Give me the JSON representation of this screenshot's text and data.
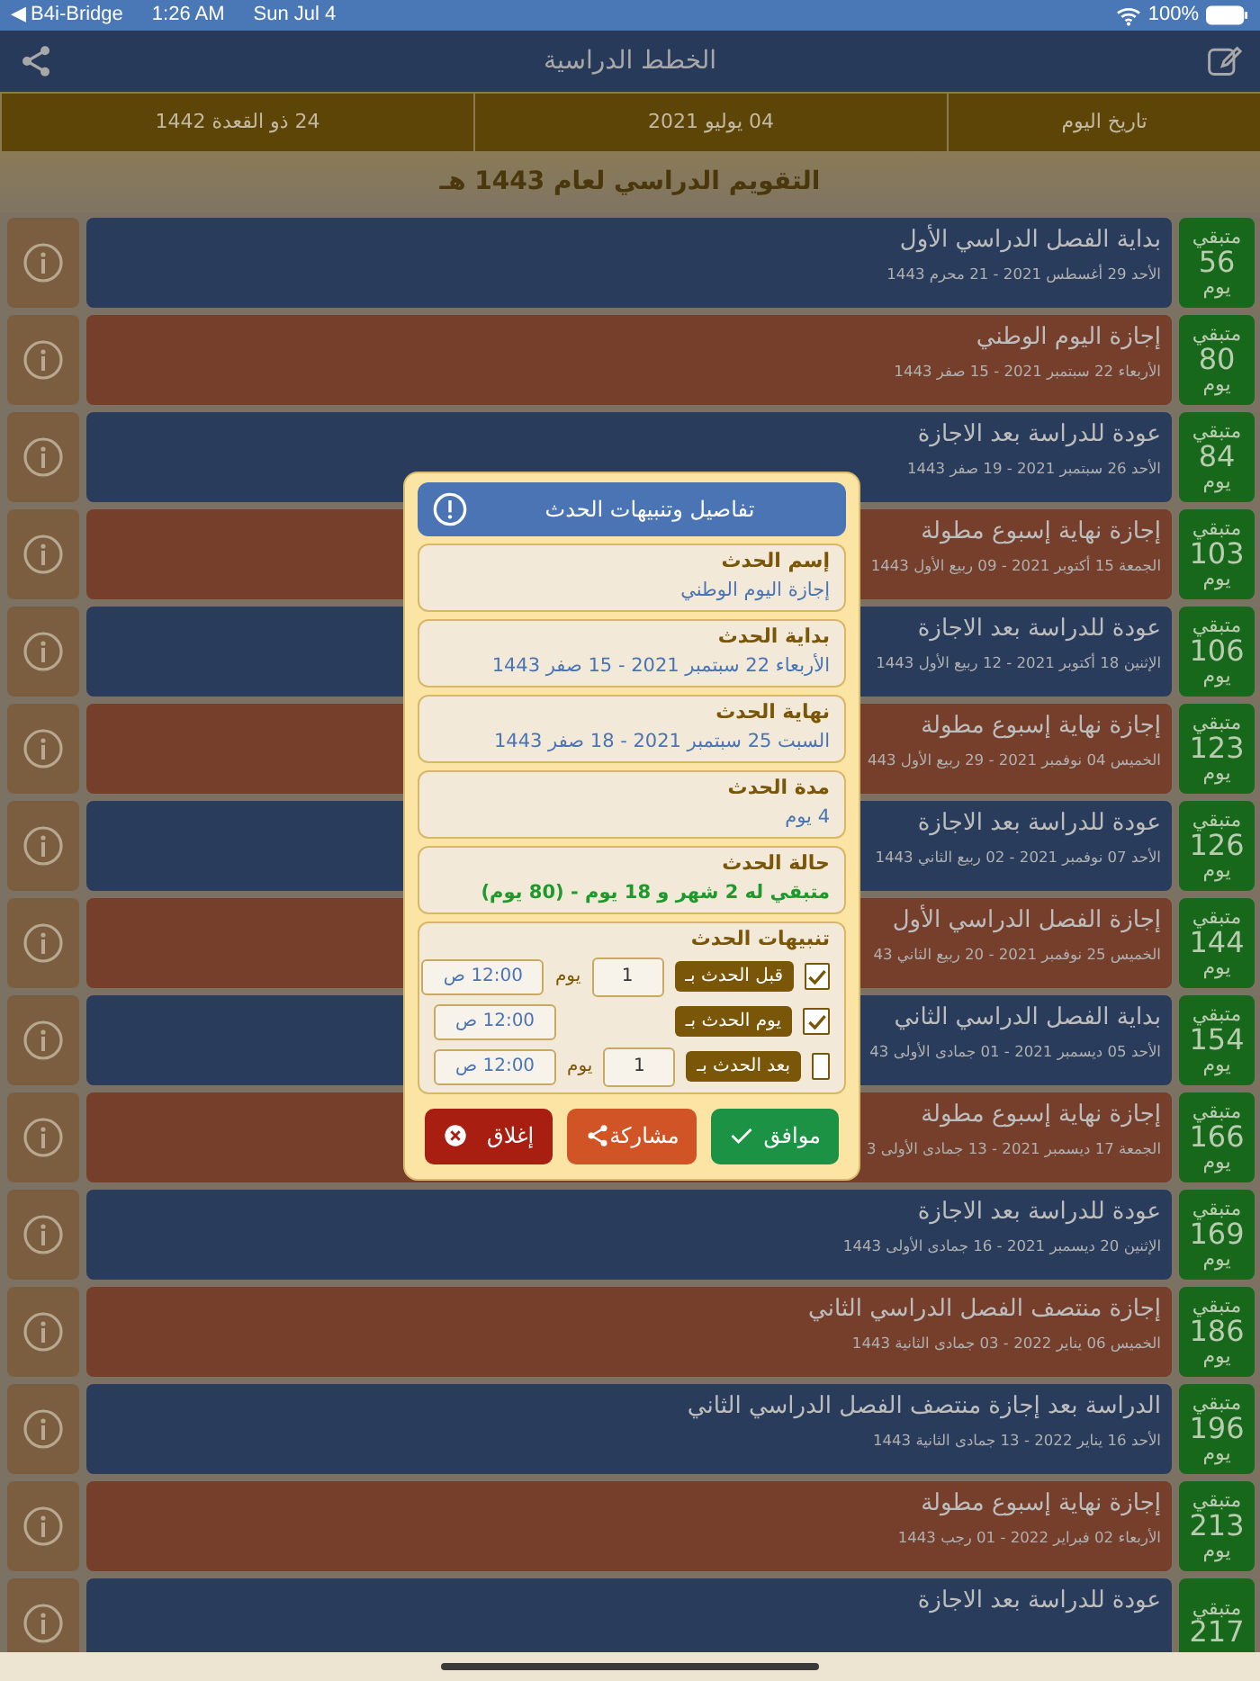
{
  "status_bar": {
    "back": "◀ B4i-Bridge",
    "time": "1:26 AM",
    "date": "Sun Jul 4",
    "battery": "100%"
  },
  "nav": {
    "title": "الخطط الدراسية"
  },
  "today": {
    "label": "تاريخ اليوم",
    "gregorian": "04 يوليو 2021",
    "hijri": "24 ذو القعدة 1442"
  },
  "calendar_title": "التقويم الدراسي لعام 1443 هـ",
  "events": [
    {
      "kind": "study",
      "title": "بداية الفصل الدراسي الأول",
      "date": "الأحد 29 أغسطس 2021 - 21 محرم 1443",
      "remaining": "متبقي",
      "days": "56",
      "unit": "يوم"
    },
    {
      "kind": "holiday",
      "title": "إجازة اليوم الوطني",
      "date": "الأربعاء 22 سبتمبر 2021 - 15 صفر 1443",
      "remaining": "متبقي",
      "days": "80",
      "unit": "يوم"
    },
    {
      "kind": "study",
      "title": "عودة للدراسة بعد الاجازة",
      "date": "الأحد 26 سبتمبر 2021 - 19 صفر 1443",
      "remaining": "متبقي",
      "days": "84",
      "unit": "يوم"
    },
    {
      "kind": "holiday",
      "title": "إجازة نهاية إسبوع مطولة",
      "date": "الجمعة 15 أكتوبر 2021 - 09 ربيع الأول 1443",
      "remaining": "متبقي",
      "days": "103",
      "unit": "يوم"
    },
    {
      "kind": "study",
      "title": "عودة للدراسة بعد الاجازة",
      "date": "الإثنين 18 أكتوبر 2021 - 12 ربيع الأول 1443",
      "remaining": "متبقي",
      "days": "106",
      "unit": "يوم"
    },
    {
      "kind": "holiday",
      "title": "إجازة نهاية إسبوع مطولة",
      "date": "الخميس 04 نوفمبر 2021 - 29 ربيع الأول 443",
      "remaining": "متبقي",
      "days": "123",
      "unit": "يوم"
    },
    {
      "kind": "study",
      "title": "عودة للدراسة بعد الاجازة",
      "date": "الأحد 07 نوفمبر 2021 - 02 ربيع الثاني 1443",
      "remaining": "متبقي",
      "days": "126",
      "unit": "يوم"
    },
    {
      "kind": "holiday",
      "title": "إجازة الفصل الدراسي الأول",
      "date": "الخميس 25 نوفمبر 2021 - 20 ربيع الثاني 43",
      "remaining": "متبقي",
      "days": "144",
      "unit": "يوم"
    },
    {
      "kind": "study",
      "title": "بداية الفصل الدراسي الثاني",
      "date": "الأحد 05 ديسمبر 2021 - 01 جمادى الأولى 43",
      "remaining": "متبقي",
      "days": "154",
      "unit": "يوم"
    },
    {
      "kind": "holiday",
      "title": "إجازة نهاية إسبوع مطولة",
      "date": "الجمعة 17 ديسمبر 2021 - 13 جمادى الأولى 3",
      "remaining": "متبقي",
      "days": "166",
      "unit": "يوم"
    },
    {
      "kind": "study",
      "title": "عودة للدراسة بعد الاجازة",
      "date": "الإثنين 20 ديسمبر 2021 - 16 جمادى الأولى 1443",
      "remaining": "متبقي",
      "days": "169",
      "unit": "يوم"
    },
    {
      "kind": "holiday",
      "title": "إجازة منتصف الفصل الدراسي الثاني",
      "date": "الخميس 06 يناير 2022 - 03 جمادى الثانية 1443",
      "remaining": "متبقي",
      "days": "186",
      "unit": "يوم"
    },
    {
      "kind": "study",
      "title": "الدراسة بعد إجازة منتصف الفصل الدراسي الثاني",
      "date": "الأحد 16 يناير 2022 - 13 جمادى الثانية 1443",
      "remaining": "متبقي",
      "days": "196",
      "unit": "يوم"
    },
    {
      "kind": "holiday",
      "title": "إجازة نهاية إسبوع مطولة",
      "date": "الأربعاء 02 فبراير 2022 - 01 رجب 1443",
      "remaining": "متبقي",
      "days": "213",
      "unit": "يوم"
    },
    {
      "kind": "study",
      "title": "عودة للدراسة بعد الاجازة",
      "remaining": "متبقي",
      "days": "217"
    }
  ],
  "dialog": {
    "title": "تفاصيل وتنبيهات الحدث",
    "fields": [
      {
        "kind": "plain",
        "label": "إسم الحدث",
        "value": "إجازة اليوم الوطني"
      },
      {
        "kind": "plain",
        "label": "بداية الحدث",
        "value": "الأربعاء 22 سبتمبر 2021 - 15 صفر 1443"
      },
      {
        "kind": "plain",
        "label": "نهاية الحدث",
        "value": "السبت 25 سبتمبر 2021 - 18 صفر 1443"
      },
      {
        "kind": "plain",
        "label": "مدة الحدث",
        "value": "4 يوم"
      },
      {
        "kind": "status",
        "label": "حالة الحدث",
        "value": "متبقي له 2 شهر و 18 يوم - (80 يوم)"
      }
    ],
    "alerts_title": "تنبيهات الحدث",
    "alerts": [
      {
        "label": "قبل الحدث بـ",
        "checked": true,
        "count": "1",
        "unit": "يوم",
        "time": "12:00 ص"
      },
      {
        "label": "يوم الحدث بـ",
        "checked": true,
        "time": "12:00 ص"
      },
      {
        "label": "بعد الحدث بـ",
        "checked": false,
        "count": "1",
        "unit": "يوم",
        "time": "12:00 ص"
      }
    ],
    "buttons": [
      {
        "kind": "ok",
        "label": "موافق"
      },
      {
        "kind": "share",
        "label": "مشاركة"
      },
      {
        "kind": "close",
        "label": "إغلاق"
      }
    ]
  }
}
